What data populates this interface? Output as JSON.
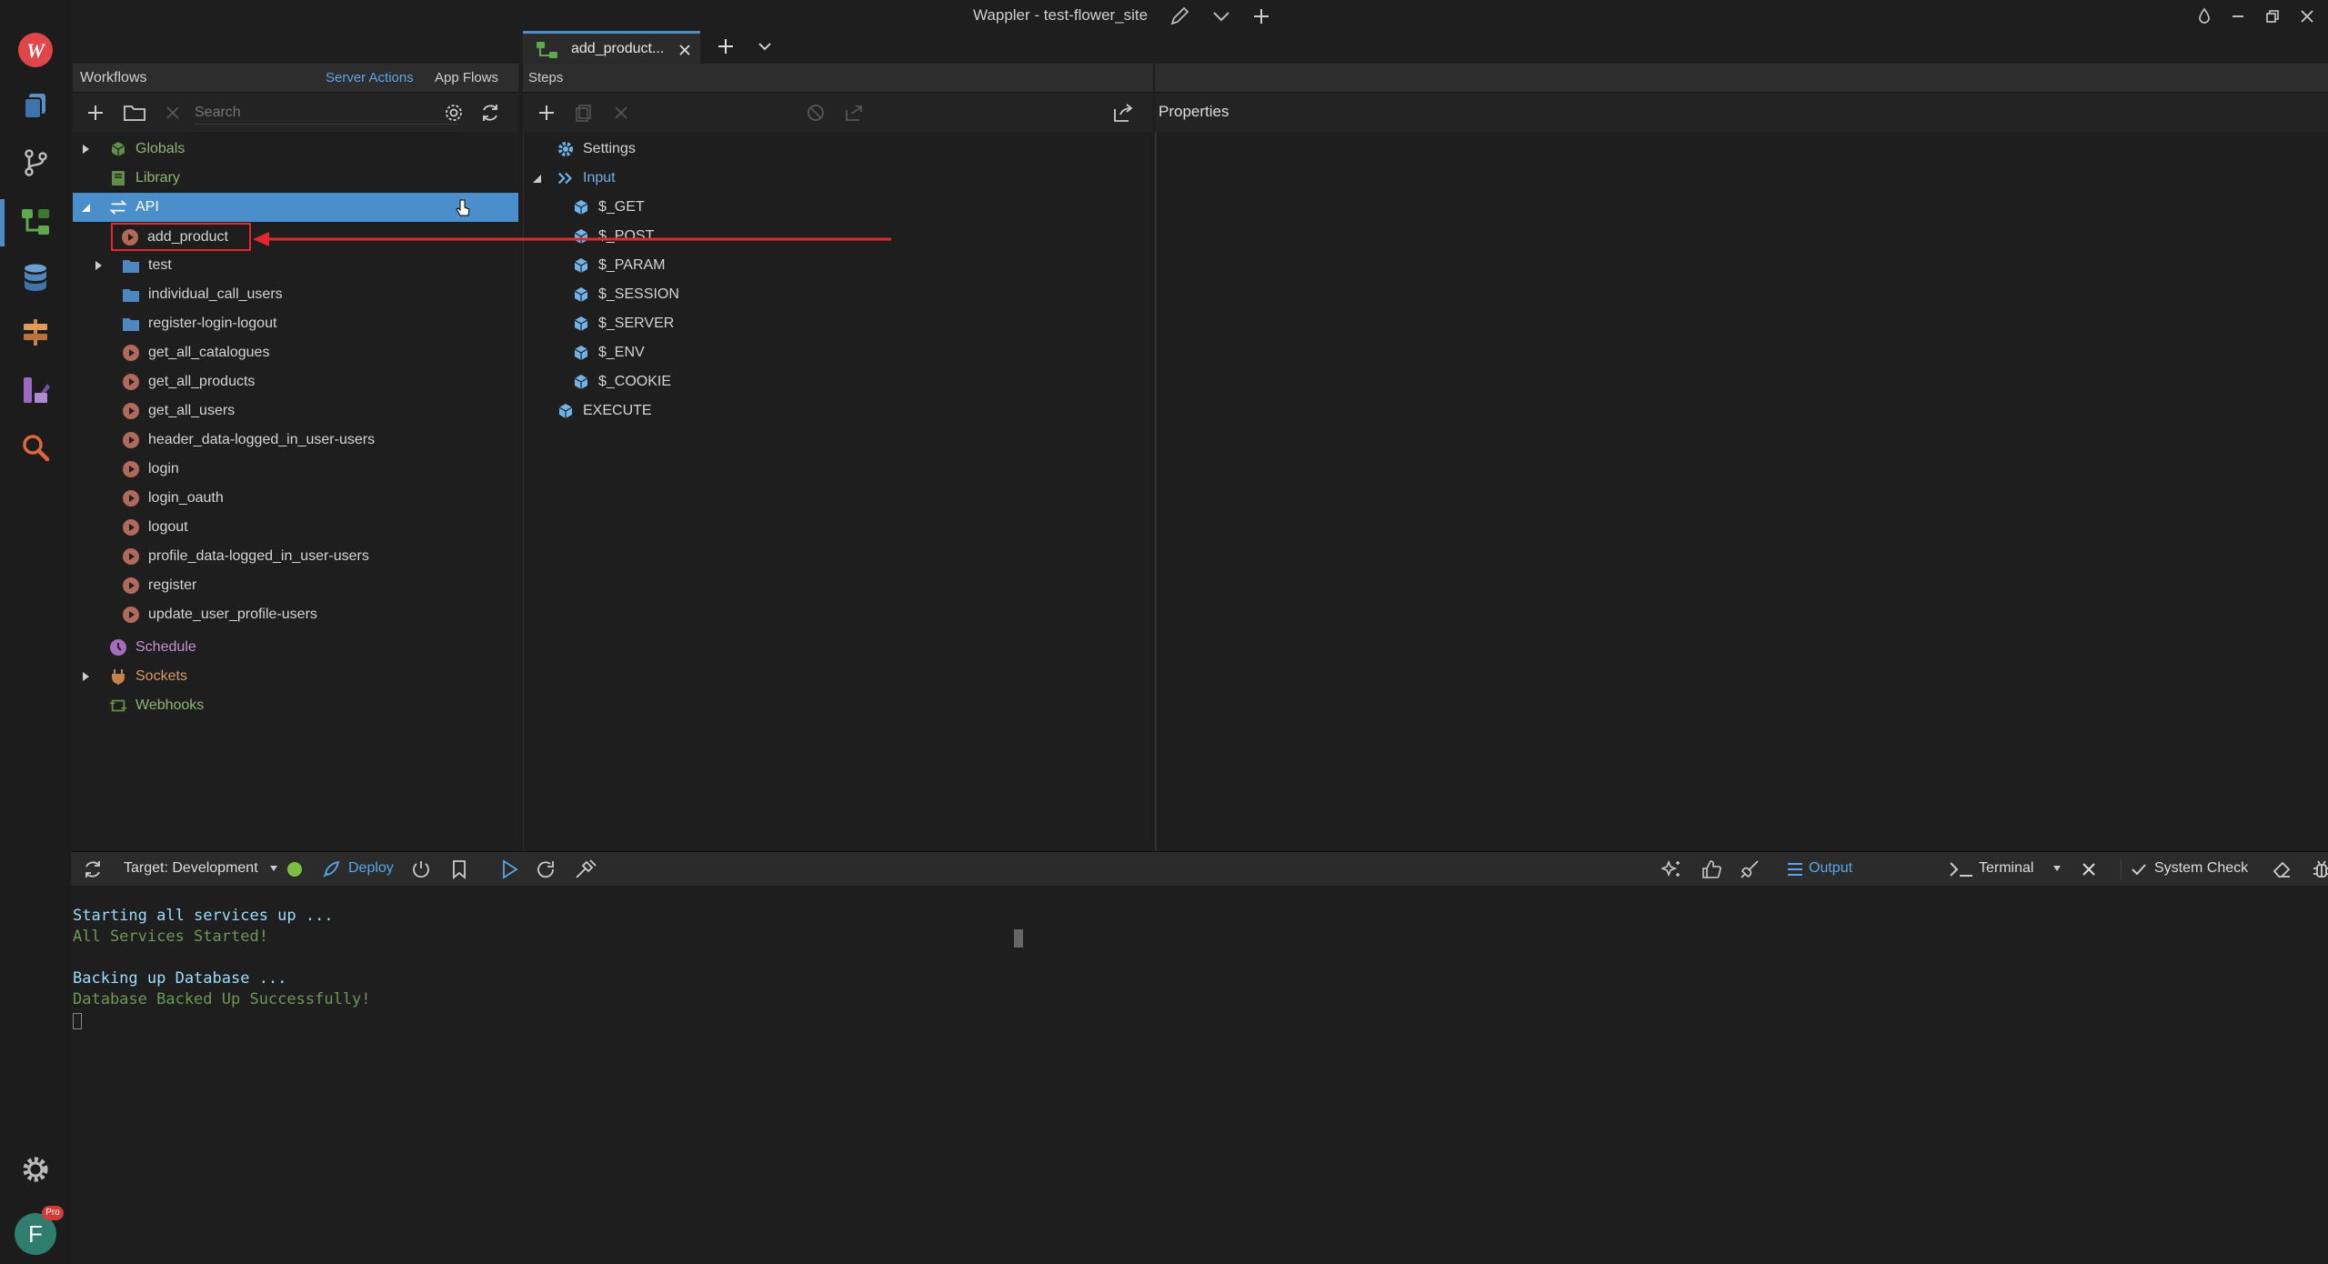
{
  "window": {
    "title": "Wappler - test-flower_site"
  },
  "tabs": [
    {
      "label": "add_product..."
    }
  ],
  "workflows": {
    "header": "Workflows",
    "links": {
      "server_actions": "Server Actions",
      "app_flows": "App Flows"
    },
    "search_placeholder": "Search",
    "tree": {
      "globals": "Globals",
      "library": "Library",
      "api": "API",
      "api_items": [
        "add_product",
        "test",
        "individual_call_users",
        "register-login-logout",
        "get_all_catalogues",
        "get_all_products",
        "get_all_users",
        "header_data-logged_in_user-users",
        "login",
        "login_oauth",
        "logout",
        "profile_data-logged_in_user-users",
        "register",
        "update_user_profile-users"
      ],
      "schedule": "Schedule",
      "sockets": "Sockets",
      "webhooks": "Webhooks"
    }
  },
  "steps": {
    "header": "Steps",
    "settings": "Settings",
    "input": "Input",
    "inputs": [
      "$_GET",
      "$_POST",
      "$_PARAM",
      "$_SESSION",
      "$_SERVER",
      "$_ENV",
      "$_COOKIE"
    ],
    "execute": "EXECUTE"
  },
  "properties": {
    "header": "Properties"
  },
  "bottombar": {
    "target": "Target: Development",
    "deploy": "Deploy",
    "output": "Output",
    "terminal": "Terminal",
    "system_check": "System Check"
  },
  "console": {
    "lines": [
      "Starting all services up ...",
      "All Services Started!",
      "",
      "Backing up Database ...",
      "Database Backed Up Successfully!"
    ]
  },
  "user": {
    "avatar_letter": "F",
    "badge": "Pro"
  },
  "colors": {
    "accent": "#4e8cc2",
    "selection": "#4a8fcb",
    "annotation": "#e0282e",
    "status_ok": "#7bc043"
  }
}
